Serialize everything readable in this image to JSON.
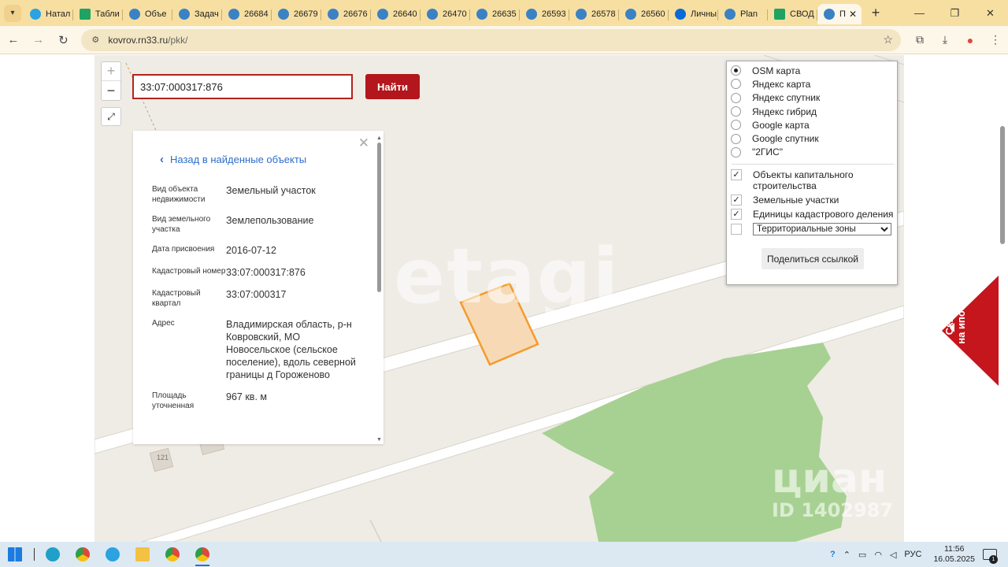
{
  "browser": {
    "tabs": [
      {
        "title": "Натал",
        "icon": "telegram-icon"
      },
      {
        "title": "Табли",
        "icon": "sheets-icon"
      },
      {
        "title": "Объе",
        "icon": "globe-icon"
      },
      {
        "title": "Задач",
        "icon": "globe-icon"
      },
      {
        "title": "26684",
        "icon": "globe-icon"
      },
      {
        "title": "26679",
        "icon": "globe-icon"
      },
      {
        "title": "26676",
        "icon": "globe-icon"
      },
      {
        "title": "26640",
        "icon": "globe-icon"
      },
      {
        "title": "26470",
        "icon": "globe-icon"
      },
      {
        "title": "26635",
        "icon": "globe-icon"
      },
      {
        "title": "26593",
        "icon": "globe-icon"
      },
      {
        "title": "26578",
        "icon": "globe-icon"
      },
      {
        "title": "26560",
        "icon": "globe-icon"
      },
      {
        "title": "Личны",
        "icon": "gosuslugi-icon"
      },
      {
        "title": "Plan",
        "icon": "globe-icon"
      },
      {
        "title": "СВОД",
        "icon": "sheets-icon"
      },
      {
        "title": "П",
        "icon": "site-icon",
        "active": true
      }
    ],
    "url_host": "kovrov.rn33.ru",
    "url_path": "/pkk/"
  },
  "search": {
    "value": "33:07:000317:876",
    "button_label": "Найти"
  },
  "zoom": {
    "plus": "+",
    "minus": "−"
  },
  "info_panel": {
    "back_label": "Назад в найденные объекты",
    "fields": [
      {
        "label": "Вид объекта недвижимости",
        "value": "Земельный участок"
      },
      {
        "label": "Вид земельного участка",
        "value": "Землепользование"
      },
      {
        "label": "Дата присвоения",
        "value": "2016-07-12"
      },
      {
        "label": "Кадастровый номер",
        "value": "33:07:000317:876"
      },
      {
        "label": "Кадастровый квартал",
        "value": "33:07:000317"
      },
      {
        "label": "Адрес",
        "value": "Владимирская область, р-н Ковровский, МО Новосельское (сельское поселение), вдоль северной границы д Гороженово"
      },
      {
        "label": "Площадь уточненная",
        "value": "967 кв. м"
      }
    ]
  },
  "layers_panel": {
    "base_maps": [
      {
        "label": "OSM карта",
        "checked": true
      },
      {
        "label": "Яндекс карта",
        "checked": false
      },
      {
        "label": "Яндекс спутник",
        "checked": false
      },
      {
        "label": "Яндекс гибрид",
        "checked": false
      },
      {
        "label": "Google карта",
        "checked": false
      },
      {
        "label": "Google спутник",
        "checked": false
      },
      {
        "label": "\"2ГИС\"",
        "checked": false
      }
    ],
    "overlays": [
      {
        "label": "Объекты капитального строительства",
        "checked": true
      },
      {
        "label": "Земельные участки",
        "checked": true
      },
      {
        "label": "Единицы кадастрового деления",
        "checked": true
      }
    ],
    "zones_select": "Территориальные зоны",
    "zones_checked": false,
    "share_label": "Поделиться ссылкой"
  },
  "map": {
    "building_label": "121",
    "watermark": "etagi",
    "cian_watermark": "циан",
    "cian_id": "ID 1402987"
  },
  "mortgage_tab": {
    "label_line1": "Скидки",
    "label_line2": "на ипотеку"
  },
  "taskbar": {
    "lang": "РУС",
    "time": "11:56",
    "date": "16.05.2025",
    "notifications": "1"
  },
  "colors": {
    "accent_red": "#b3161c",
    "parcel_fill": "#f7d9b5",
    "parcel_stroke": "#f39c2b",
    "forest": "#a7d192"
  }
}
